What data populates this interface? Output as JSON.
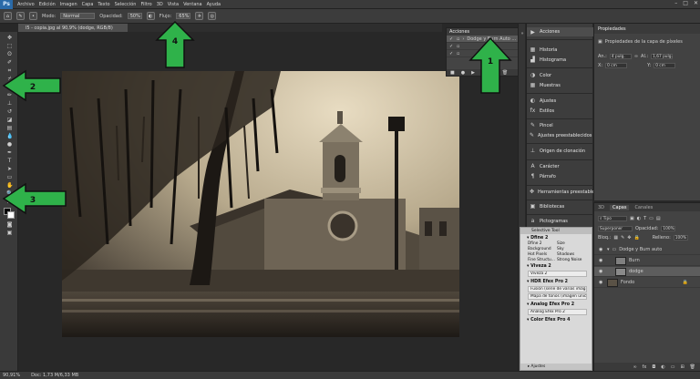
{
  "app": {
    "logo": "Ps"
  },
  "menu": [
    "Archivo",
    "Edición",
    "Imagen",
    "Capa",
    "Texto",
    "Selección",
    "Filtro",
    "3D",
    "Vista",
    "Ventana",
    "Ayuda"
  ],
  "window_controls": [
    "–",
    "□",
    "✕"
  ],
  "options_bar": {
    "mode_label": "Modo:",
    "mode_value": "Normal",
    "opacity_label": "Opacidad:",
    "opacity_value": "50%",
    "flow_label": "Flujo:",
    "flow_value": "65%"
  },
  "document_tab": "l5 - copia.jpg al 90,9% (dodge, RGB/8)",
  "status": {
    "zoom": "90,91%",
    "doc": "Doc: 1,73 M/6,33 MB"
  },
  "actions_panel": {
    "title": "Acciones",
    "rows": [
      {
        "label": "Dodge y Burn Auto ...",
        "selected": true
      },
      {
        "label": "",
        "selected": false
      },
      {
        "label": "",
        "selected": false
      }
    ]
  },
  "dock": [
    {
      "label": "Acciones",
      "icon": "play-icon"
    },
    {
      "label": "Historia",
      "icon": "history-icon"
    },
    {
      "label": "Histograma",
      "icon": "histogram-icon"
    },
    {
      "label": "Color",
      "icon": "color-icon"
    },
    {
      "label": "Muestras",
      "icon": "swatches-icon"
    },
    {
      "label": "Ajustes",
      "icon": "adjustments-icon"
    },
    {
      "label": "Estilos",
      "icon": "styles-icon"
    },
    {
      "label": "Pincel",
      "icon": "brush-icon"
    },
    {
      "label": "Ajustes preestablecidos de pin...",
      "icon": "brush-presets-icon"
    },
    {
      "label": "Origen de clonación",
      "icon": "clone-source-icon"
    },
    {
      "label": "Carácter",
      "icon": "character-icon"
    },
    {
      "label": "Párrafo",
      "icon": "paragraph-icon"
    },
    {
      "label": "Herramientas preestablecidas",
      "icon": "tool-presets-icon"
    },
    {
      "label": "Bibliotecas",
      "icon": "libraries-icon"
    },
    {
      "label": "Pictogramas",
      "icon": "glyphs-icon"
    }
  ],
  "selective_tool": {
    "title": "Selective Tool",
    "sections": [
      {
        "name": "Dfine 2",
        "grid": [
          "Dfine 2",
          "Size",
          "Background",
          "Sky",
          "Hot Pixels",
          "Shadows",
          "Fine Structu...",
          "Strong Noise"
        ]
      },
      {
        "name": "Viveza 2",
        "lines": [
          "Viveza 2"
        ]
      },
      {
        "name": "HDR Efex Pro 2",
        "lines": [
          "Fusión (serie de varias imág...",
          "Mapa de tonos (imagen única)"
        ]
      },
      {
        "name": "Analog Efex Pro 2",
        "lines": [
          "Analog Efex Pro 2"
        ]
      },
      {
        "name": "Color Efex Pro 4",
        "lines": []
      }
    ],
    "footer": "Ajustes"
  },
  "properties": {
    "title": "Propiedades",
    "subtitle": "Propiedades de la capa de píxeles",
    "w_label": "An.:",
    "w_value": "4 pulg.",
    "h_label": "Al.:",
    "h_value": "1,67 pulg.",
    "x_label": "X:",
    "x_value": "0 cm",
    "y_label": "Y:",
    "y_value": "0 cm"
  },
  "layers": {
    "tabs": [
      "3D",
      "Capas",
      "Canales"
    ],
    "active_tab": "Capas",
    "kind_label": "Tipo",
    "blend": "Superponer",
    "opacity_label": "Opacidad:",
    "opacity_value": "100%",
    "lock_label": "Bloq.:",
    "fill_label": "Relleno:",
    "fill_value": "100%",
    "rows": [
      {
        "name": "Dodge y Burn auto",
        "type": "group",
        "selected": false
      },
      {
        "name": "Burn",
        "type": "layer",
        "selected": false
      },
      {
        "name": "dodge",
        "type": "layer",
        "selected": true
      },
      {
        "name": "Fondo",
        "type": "background",
        "selected": false
      }
    ]
  },
  "annotations": [
    {
      "label": "1",
      "color": "#2fb24a"
    },
    {
      "label": "2",
      "color": "#2fb24a"
    },
    {
      "label": "3",
      "color": "#2fb24a"
    },
    {
      "label": "4",
      "color": "#2fb24a"
    }
  ]
}
